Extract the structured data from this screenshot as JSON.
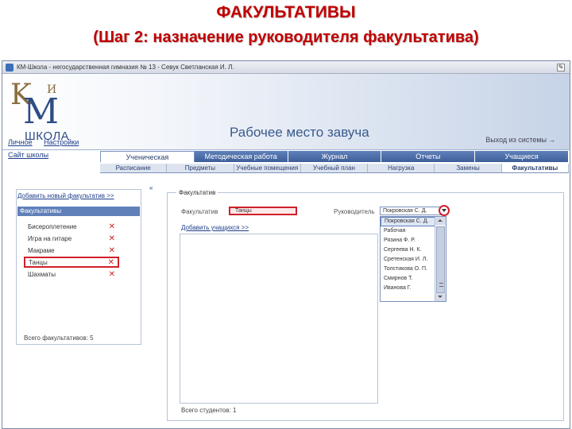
{
  "slide": {
    "title": "ФАКУЛЬТАТИВЫ",
    "subtitle": "(Шаг 2: назначение руководителя факультатива)"
  },
  "window": {
    "title": "КМ-Школа - негосударственная гимназия № 13 - Севук Светланская И. Л."
  },
  "banner": {
    "logo_i": "И",
    "logo_school": "ШКОЛА",
    "workplace": "Рабочее место завуча",
    "exit": "Выход из системы"
  },
  "top_links": [
    "Личное",
    "Настройки"
  ],
  "site_link": "Сайт школы",
  "tabs": [
    "Ученическая",
    "Методическая работа",
    "Журнал",
    "Отчеты",
    "Учащиеся"
  ],
  "subtabs": [
    "Расписание",
    "Предметы",
    "Учебные помещения",
    "Учебный план",
    "Нагрузка",
    "Замены",
    "Факультативы"
  ],
  "left_panel": {
    "add_link": "Добавить новый факультатив >>",
    "header": "Факультативы",
    "items": [
      "Бисероплетение",
      "Игра на гитаре",
      "Макраме",
      "Танцы",
      "Шахматы"
    ],
    "delete_icon": "✕",
    "total": "Всего факультативов: 5"
  },
  "collapse_btn": "«",
  "form": {
    "legend": "Факультатив",
    "elective_label": "Факультатив",
    "elective_value": "Танцы",
    "leader_label": "Руководитель",
    "leader_value": "Покровская С. Д.",
    "add_students": "Добавить учащихся >>",
    "students_total": "Всего студентов: 1"
  },
  "dropdown": {
    "items": [
      "Покровская С. Д.",
      "Рабочая",
      "Рязина Ф. Р.",
      "Сергеева Н. К.",
      "Сретенская И. Л.",
      "Толстикова О. П.",
      "Смирнов Т.",
      "Иванова Г."
    ],
    "highlighted_index": 0
  },
  "colors": {
    "accent_red": "#d0202a",
    "tab_blue": "#3e5f9b",
    "title_red": "#c00000"
  }
}
